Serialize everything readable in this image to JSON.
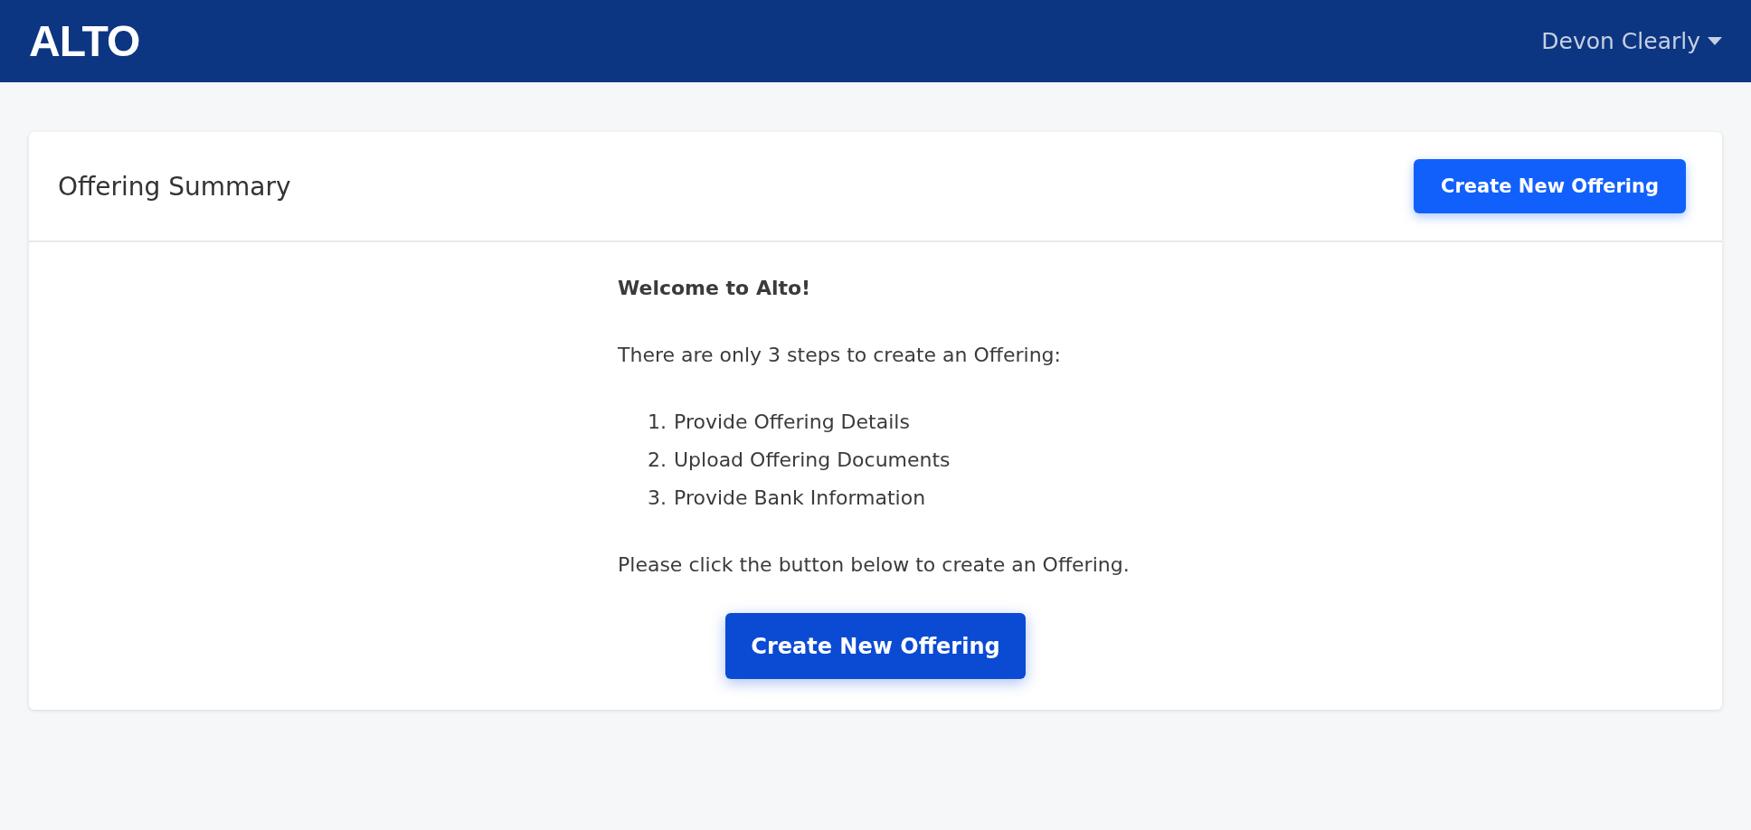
{
  "navbar": {
    "logo": "ALTO",
    "user_menu": "Devon Clearly"
  },
  "card": {
    "title": "Offering Summary",
    "header_button": "Create New Offering",
    "welcome": "Welcome to Alto!",
    "intro": "There are only 3 steps to create an Offering:",
    "steps": [
      {
        "number": "1.",
        "text": "Provide Offering Details"
      },
      {
        "number": "2.",
        "text": "Upload Offering Documents"
      },
      {
        "number": "3.",
        "text": "Provide Bank Information"
      }
    ],
    "instruction": "Please click the button below to create an Offering.",
    "main_button": "Create New Offering"
  }
}
